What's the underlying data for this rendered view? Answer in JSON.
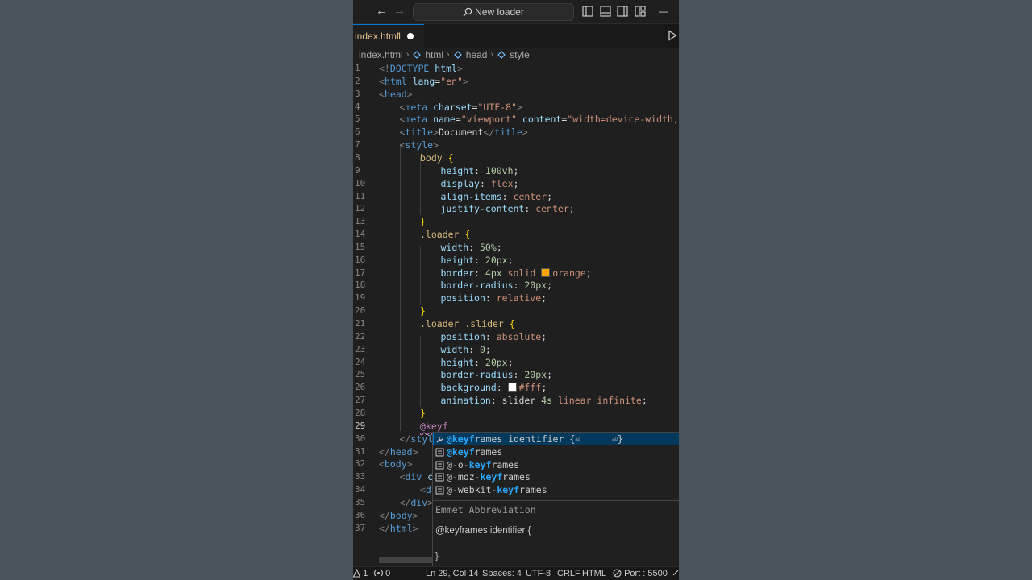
{
  "titlebar": {
    "back_glyph": "←",
    "forward_glyph": "→",
    "search_text": "New loader",
    "minimize_glyph": "—"
  },
  "tab": {
    "label": "index.html",
    "problems_badge": "1"
  },
  "breadcrumbs": [
    "index.html",
    "html",
    "head",
    "style"
  ],
  "editor": {
    "current_line": 29,
    "lines": [
      {
        "n": "1",
        "indent": 0,
        "tokens": [
          [
            "p",
            "<!"
          ],
          [
            "tag",
            "DOCTYPE"
          ],
          [
            "t",
            " "
          ],
          [
            "attr",
            "html"
          ],
          [
            "p",
            ">"
          ]
        ]
      },
      {
        "n": "2",
        "indent": 0,
        "tokens": [
          [
            "p",
            "<"
          ],
          [
            "tag",
            "html"
          ],
          [
            "t",
            " "
          ],
          [
            "attr",
            "lang"
          ],
          [
            "t",
            "="
          ],
          [
            "str",
            "\"en\""
          ],
          [
            "p",
            ">"
          ]
        ]
      },
      {
        "n": "3",
        "indent": 0,
        "tokens": [
          [
            "p",
            "<"
          ],
          [
            "tag",
            "head"
          ],
          [
            "p",
            ">"
          ]
        ]
      },
      {
        "n": "4",
        "indent": 1,
        "tokens": [
          [
            "p",
            "<"
          ],
          [
            "tag",
            "meta"
          ],
          [
            "t",
            " "
          ],
          [
            "attr",
            "charset"
          ],
          [
            "t",
            "="
          ],
          [
            "str",
            "\"UTF-8\""
          ],
          [
            "p",
            ">"
          ]
        ]
      },
      {
        "n": "5",
        "indent": 1,
        "tokens": [
          [
            "p",
            "<"
          ],
          [
            "tag",
            "meta"
          ],
          [
            "t",
            " "
          ],
          [
            "attr",
            "name"
          ],
          [
            "t",
            "="
          ],
          [
            "str",
            "\"viewport\""
          ],
          [
            "t",
            " "
          ],
          [
            "attr",
            "content"
          ],
          [
            "t",
            "="
          ],
          [
            "str",
            "\"width=device-width, ini"
          ]
        ]
      },
      {
        "n": "6",
        "indent": 1,
        "tokens": [
          [
            "p",
            "<"
          ],
          [
            "tag",
            "title"
          ],
          [
            "p",
            ">"
          ],
          [
            "t",
            "Document"
          ],
          [
            "p",
            "</"
          ],
          [
            "tag",
            "title"
          ],
          [
            "p",
            ">"
          ]
        ]
      },
      {
        "n": "7",
        "indent": 1,
        "tokens": [
          [
            "p",
            "<"
          ],
          [
            "tag",
            "style"
          ],
          [
            "p",
            ">"
          ]
        ]
      },
      {
        "n": "8",
        "indent": 2,
        "tokens": [
          [
            "sel",
            "body"
          ],
          [
            "t",
            " "
          ],
          [
            "brace",
            "{"
          ]
        ]
      },
      {
        "n": "9",
        "indent": 3,
        "tokens": [
          [
            "prop",
            "height"
          ],
          [
            "t",
            ": "
          ],
          [
            "num",
            "100vh"
          ],
          [
            "t",
            ";"
          ]
        ]
      },
      {
        "n": "10",
        "indent": 3,
        "tokens": [
          [
            "prop",
            "display"
          ],
          [
            "t",
            ": "
          ],
          [
            "val",
            "flex"
          ],
          [
            "t",
            ";"
          ]
        ]
      },
      {
        "n": "11",
        "indent": 3,
        "tokens": [
          [
            "prop",
            "align-items"
          ],
          [
            "t",
            ": "
          ],
          [
            "val",
            "center"
          ],
          [
            "t",
            ";"
          ]
        ]
      },
      {
        "n": "12",
        "indent": 3,
        "tokens": [
          [
            "prop",
            "justify-content"
          ],
          [
            "t",
            ": "
          ],
          [
            "val",
            "center"
          ],
          [
            "t",
            ";"
          ]
        ]
      },
      {
        "n": "13",
        "indent": 2,
        "tokens": [
          [
            "brace",
            "}"
          ]
        ]
      },
      {
        "n": "14",
        "indent": 2,
        "tokens": [
          [
            "sel",
            ".loader"
          ],
          [
            "t",
            " "
          ],
          [
            "brace",
            "{"
          ]
        ]
      },
      {
        "n": "15",
        "indent": 3,
        "tokens": [
          [
            "prop",
            "width"
          ],
          [
            "t",
            ": "
          ],
          [
            "num",
            "50%"
          ],
          [
            "t",
            ";"
          ]
        ]
      },
      {
        "n": "16",
        "indent": 3,
        "tokens": [
          [
            "prop",
            "height"
          ],
          [
            "t",
            ": "
          ],
          [
            "num",
            "20px"
          ],
          [
            "t",
            ";"
          ]
        ]
      },
      {
        "n": "17",
        "indent": 3,
        "tokens": [
          [
            "prop",
            "border"
          ],
          [
            "t",
            ": "
          ],
          [
            "num",
            "4px"
          ],
          [
            "t",
            " "
          ],
          [
            "val",
            "solid"
          ],
          [
            "t",
            " "
          ],
          [
            "swatch",
            "#ffa500"
          ],
          [
            "val",
            "orange"
          ],
          [
            "t",
            ";"
          ]
        ]
      },
      {
        "n": "18",
        "indent": 3,
        "tokens": [
          [
            "prop",
            "border-radius"
          ],
          [
            "t",
            ": "
          ],
          [
            "num",
            "20px"
          ],
          [
            "t",
            ";"
          ]
        ]
      },
      {
        "n": "19",
        "indent": 3,
        "tokens": [
          [
            "prop",
            "position"
          ],
          [
            "t",
            ": "
          ],
          [
            "val",
            "relative"
          ],
          [
            "t",
            ";"
          ]
        ]
      },
      {
        "n": "20",
        "indent": 2,
        "tokens": [
          [
            "brace",
            "}"
          ]
        ]
      },
      {
        "n": "21",
        "indent": 2,
        "tokens": [
          [
            "sel",
            ".loader .slider"
          ],
          [
            "t",
            " "
          ],
          [
            "brace",
            "{"
          ]
        ]
      },
      {
        "n": "22",
        "indent": 3,
        "tokens": [
          [
            "prop",
            "position"
          ],
          [
            "t",
            ": "
          ],
          [
            "val",
            "absolute"
          ],
          [
            "t",
            ";"
          ]
        ]
      },
      {
        "n": "23",
        "indent": 3,
        "tokens": [
          [
            "prop",
            "width"
          ],
          [
            "t",
            ": "
          ],
          [
            "num",
            "0"
          ],
          [
            "t",
            ";"
          ]
        ]
      },
      {
        "n": "24",
        "indent": 3,
        "tokens": [
          [
            "prop",
            "height"
          ],
          [
            "t",
            ": "
          ],
          [
            "num",
            "20px"
          ],
          [
            "t",
            ";"
          ]
        ]
      },
      {
        "n": "25",
        "indent": 3,
        "tokens": [
          [
            "prop",
            "border-radius"
          ],
          [
            "t",
            ": "
          ],
          [
            "num",
            "20px"
          ],
          [
            "t",
            ";"
          ]
        ]
      },
      {
        "n": "26",
        "indent": 3,
        "tokens": [
          [
            "prop",
            "background"
          ],
          [
            "t",
            ": "
          ],
          [
            "swatch",
            "#ffffff"
          ],
          [
            "val",
            "#fff"
          ],
          [
            "t",
            ";"
          ]
        ]
      },
      {
        "n": "27",
        "indent": 3,
        "tokens": [
          [
            "prop",
            "animation"
          ],
          [
            "t",
            ": "
          ],
          [
            "t",
            "slider "
          ],
          [
            "num",
            "4s"
          ],
          [
            "t",
            " "
          ],
          [
            "val",
            "linear"
          ],
          [
            "t",
            " "
          ],
          [
            "val",
            "infinite"
          ],
          [
            "t",
            ";"
          ]
        ]
      },
      {
        "n": "28",
        "indent": 2,
        "tokens": [
          [
            "brace",
            "}"
          ]
        ]
      },
      {
        "n": "29",
        "indent": 2,
        "tokens": [
          [
            "at",
            "@keyf"
          ]
        ]
      },
      {
        "n": "30",
        "indent": 1,
        "tokens": [
          [
            "p",
            "</"
          ],
          [
            "tag",
            "styl"
          ]
        ]
      },
      {
        "n": "31",
        "indent": 0,
        "tokens": [
          [
            "p",
            "</"
          ],
          [
            "tag",
            "head"
          ],
          [
            "p",
            ">"
          ]
        ]
      },
      {
        "n": "32",
        "indent": 0,
        "tokens": [
          [
            "p",
            "<"
          ],
          [
            "tag",
            "body"
          ],
          [
            "p",
            ">"
          ]
        ]
      },
      {
        "n": "33",
        "indent": 1,
        "tokens": [
          [
            "p",
            "<"
          ],
          [
            "tag",
            "div"
          ],
          [
            "t",
            " "
          ],
          [
            "attr",
            "c"
          ]
        ]
      },
      {
        "n": "34",
        "indent": 2,
        "tokens": [
          [
            "p",
            "<"
          ],
          [
            "tag",
            "d"
          ]
        ]
      },
      {
        "n": "35",
        "indent": 1,
        "tokens": [
          [
            "p",
            "</"
          ],
          [
            "tag",
            "div"
          ],
          [
            "p",
            ">"
          ]
        ]
      },
      {
        "n": "36",
        "indent": 0,
        "tokens": [
          [
            "p",
            "</"
          ],
          [
            "tag",
            "body"
          ],
          [
            "p",
            ">"
          ]
        ]
      },
      {
        "n": "37",
        "indent": 0,
        "tokens": [
          [
            "p",
            "</"
          ],
          [
            "tag",
            "html"
          ],
          [
            "p",
            ">"
          ]
        ]
      }
    ]
  },
  "suggestions": {
    "items": [
      {
        "icon": "wrench-icon",
        "match": "@keyf",
        "rest": "rames identifier {⏎",
        "extra": "⏎}",
        "selected": true
      },
      {
        "icon": "snippet-icon",
        "match": "@keyf",
        "rest": "rames",
        "prefix": ""
      },
      {
        "icon": "snippet-icon",
        "prefix": "@-o-",
        "match": "keyf",
        "rest": "rames"
      },
      {
        "icon": "snippet-icon",
        "prefix": "@-moz-",
        "match": "keyf",
        "rest": "rames"
      },
      {
        "icon": "snippet-icon",
        "prefix": "@-webkit-",
        "match": "keyf",
        "rest": "rames"
      }
    ],
    "doc_title": "Emmet Abbreviation",
    "doc_line1": "@keyframes identifier {",
    "doc_line3": "}"
  },
  "statusbar": {
    "problems_count": "1",
    "warnings_count": "0",
    "position": "Ln 29, Col 14",
    "spaces": "Spaces: 4",
    "encoding": "UTF-8",
    "eol": "CRLF",
    "language": "HTML",
    "port": "Port : 5500"
  }
}
